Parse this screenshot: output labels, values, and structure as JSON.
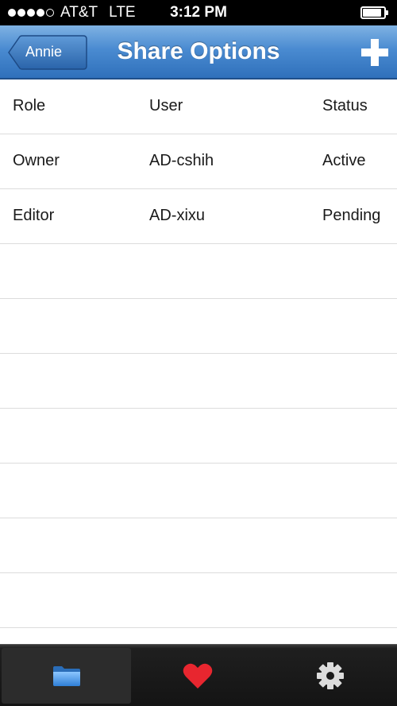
{
  "status_bar": {
    "carrier": "AT&T",
    "network": "LTE",
    "time": "3:12 PM",
    "signal_bars": 4,
    "signal_max": 5,
    "battery_level": 0.9
  },
  "nav": {
    "back_label": "Annie",
    "title": "Share Options",
    "add_icon": "plus-icon"
  },
  "table": {
    "header": {
      "role": "Role",
      "user": "User",
      "status": "Status"
    },
    "rows": [
      {
        "role": "Owner",
        "user": "AD-cshih",
        "status": "Active"
      },
      {
        "role": "Editor",
        "user": "AD-xixu",
        "status": "Pending"
      }
    ]
  },
  "tab_bar": {
    "tabs": [
      {
        "icon": "folder-icon",
        "selected": true
      },
      {
        "icon": "heart-icon",
        "selected": false
      },
      {
        "icon": "gear-icon",
        "selected": false
      }
    ]
  },
  "colors": {
    "nav_blue": "#4a8bd1",
    "heart_red": "#e8262f",
    "folder_blue": "#3d8fe0",
    "gear_gray": "#dcdcdc"
  }
}
